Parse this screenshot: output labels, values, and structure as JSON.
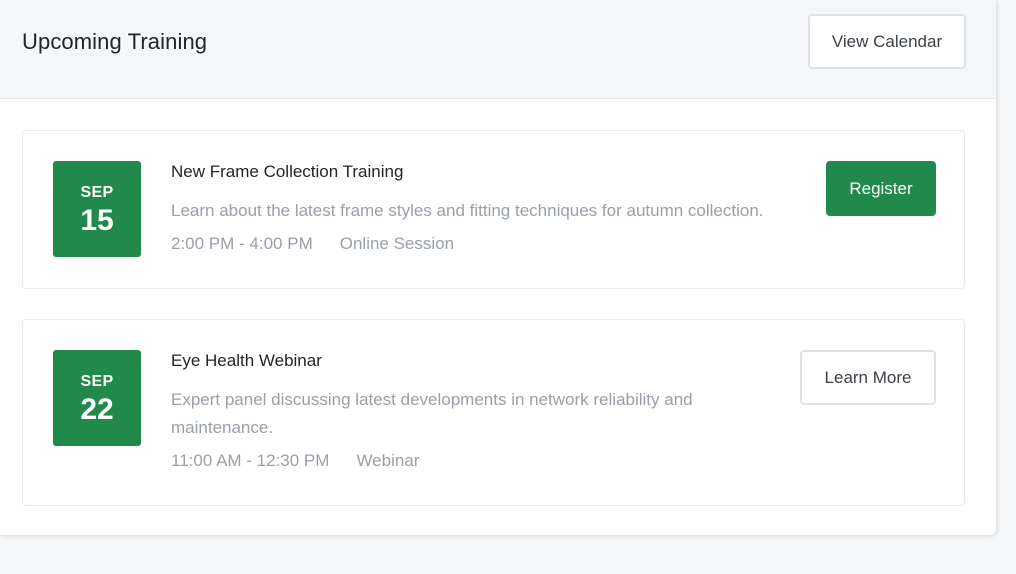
{
  "header": {
    "title": "Upcoming Training",
    "view_calendar_label": "View Calendar"
  },
  "events": [
    {
      "month": "SEP",
      "day": "15",
      "title": "New Frame Collection Training",
      "description": "Learn about the latest frame styles and fitting techniques for autumn collection.",
      "time": "2:00 PM - 4:00 PM",
      "location": "Online Session",
      "action_label": "Register"
    },
    {
      "month": "SEP",
      "day": "22",
      "title": "Eye Health Webinar",
      "description": "Expert panel discussing latest developments in network reliability and maintenance.",
      "time": "11:00 AM - 12:30 PM",
      "location": "Webinar",
      "action_label": "Learn More"
    }
  ],
  "colors": {
    "accent": "#21894c",
    "muted_text": "#9aa0a8",
    "page_background": "#f5f6f8"
  }
}
